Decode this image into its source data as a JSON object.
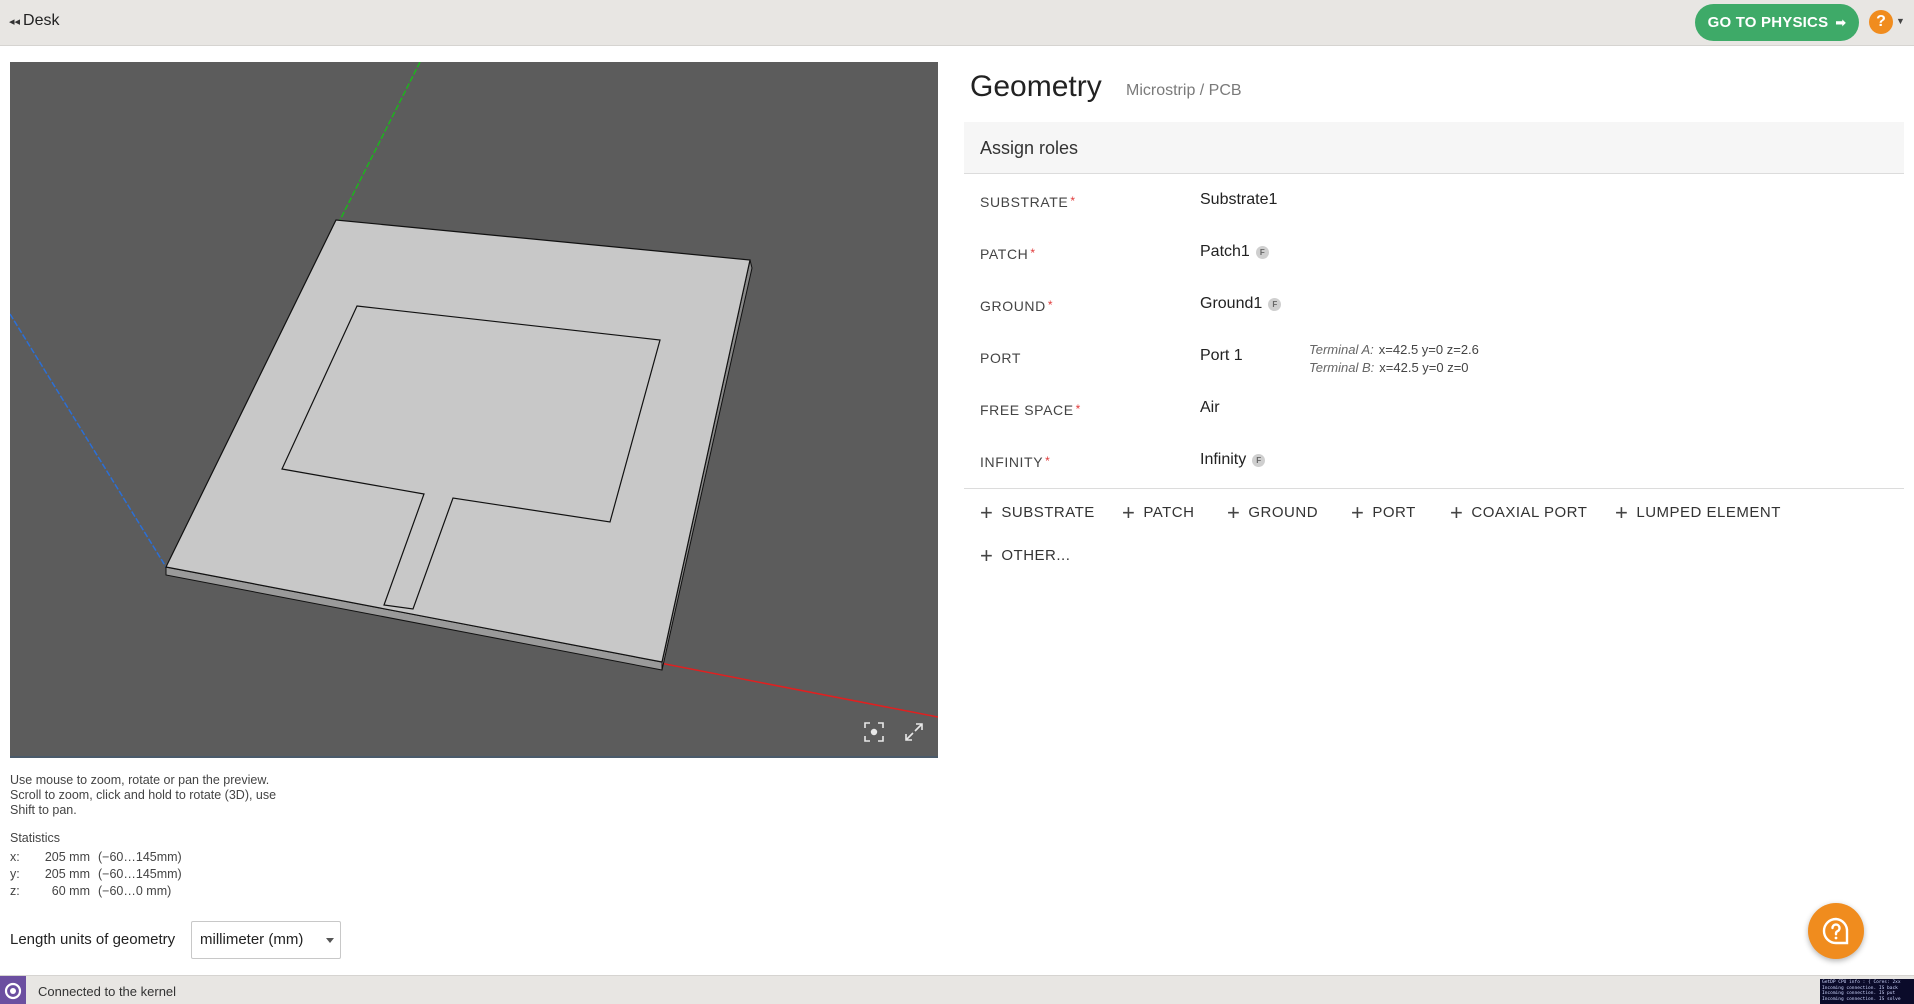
{
  "topbar": {
    "back_label": "Desk",
    "physics_label": "GO TO PHYSICS",
    "help_glyph": "?"
  },
  "viewport": {
    "help_text": "Use mouse to zoom, rotate or pan the preview. Scroll to zoom, click and hold to rotate (3D), use Shift to pan.",
    "background_color": "#5c5c5c",
    "model_color": "#c8c8c8"
  },
  "statistics": {
    "title": "Statistics",
    "rows": [
      {
        "axis": "x:",
        "size": "205 mm",
        "range": "(−60…145mm)"
      },
      {
        "axis": "y:",
        "size": "205 mm",
        "range": "(−60…145mm)"
      },
      {
        "axis": "z:",
        "size": "60 mm",
        "range": "(−60…0    mm)"
      }
    ]
  },
  "units": {
    "label": "Length units of geometry",
    "selected": "millimeter (mm)"
  },
  "status": {
    "text": "Connected to the kernel",
    "console_lines": [
      "GetDP CPU info : { Cores: 2xx",
      "Incoming connection. IS back",
      "Incoming connection. IS put",
      "Incoming connection. IS solve"
    ]
  },
  "panel": {
    "title": "Geometry",
    "subtitle": "Microstrip / PCB",
    "section_title": "Assign roles",
    "roles": [
      {
        "label": "SUBSTRATE",
        "required": true,
        "value": "Substrate1",
        "f_badge": false
      },
      {
        "label": "PATCH",
        "required": true,
        "value": "Patch1",
        "f_badge": true
      },
      {
        "label": "GROUND",
        "required": true,
        "value": "Ground1",
        "f_badge": true
      },
      {
        "label": "PORT",
        "required": false,
        "value": "Port 1",
        "f_badge": false
      },
      {
        "label": "FREE SPACE",
        "required": true,
        "value": "Air",
        "f_badge": false
      },
      {
        "label": "INFINITY",
        "required": true,
        "value": "Infinity",
        "f_badge": true
      }
    ],
    "required_mark": "*",
    "f_badge_text": "F",
    "terminal_a": {
      "label": "Terminal A:",
      "value": "x=42.5  y=0  z=2.6"
    },
    "terminal_b": {
      "label": "Terminal B:",
      "value": "x=42.5  y=0  z=0"
    },
    "add_buttons": [
      "SUBSTRATE",
      "PATCH",
      "GROUND",
      "PORT",
      "COAXIAL PORT",
      "LUMPED ELEMENT",
      "OTHER..."
    ]
  },
  "colors": {
    "accent_green": "#3eaa68",
    "help_orange": "#f08c1e",
    "required_red": "#e03a3a",
    "kernel_purple": "#6b4fa0"
  }
}
